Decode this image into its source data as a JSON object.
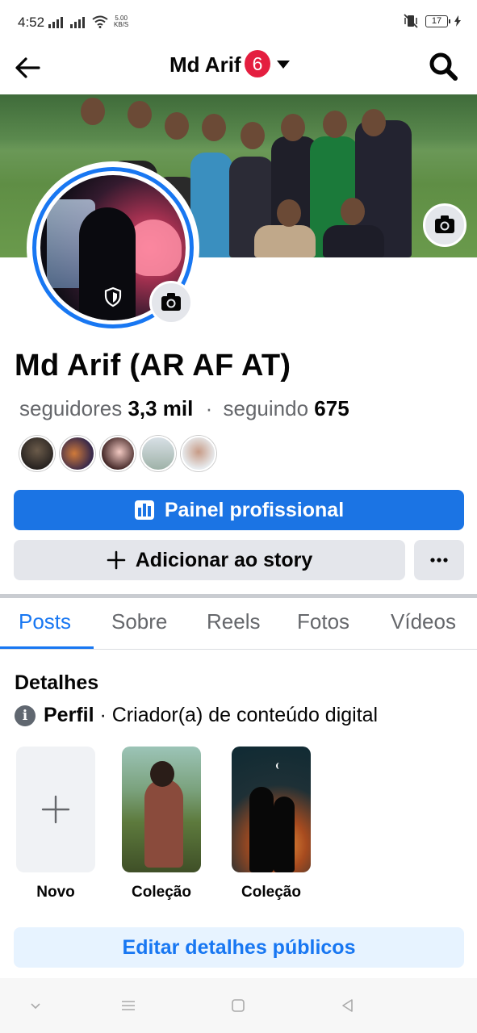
{
  "status": {
    "time": "4:52",
    "netspeed_value": "5.00",
    "netspeed_unit": "KB/S",
    "battery": "17"
  },
  "header": {
    "title": "Md Arif",
    "badge": "6"
  },
  "profile": {
    "name": "Md Arif (AR AF AT)",
    "followers_label": "seguidores",
    "followers_value": "3,3 mil",
    "separator": "·",
    "following_label": "seguindo",
    "following_value": "675"
  },
  "buttons": {
    "dashboard": "Painel profissional",
    "add_story": "Adicionar ao story",
    "more": "···",
    "edit_details": "Editar detalhes públicos"
  },
  "tabs": [
    {
      "label": "Posts",
      "active": true
    },
    {
      "label": "Sobre"
    },
    {
      "label": "Reels"
    },
    {
      "label": "Fotos"
    },
    {
      "label": "Vídeos"
    }
  ],
  "details": {
    "title": "Detalhes",
    "profile_key": "Perfil",
    "profile_value": "· Criador(a) de conteúdo digital"
  },
  "featured": [
    {
      "label": "Novo"
    },
    {
      "label": "Coleção"
    },
    {
      "label": "Coleção"
    }
  ],
  "colors": {
    "accent": "#1877f2",
    "badge": "#e41e3f",
    "button_gray": "#e4e6eb",
    "light_blue": "#e7f3ff"
  },
  "icons": [
    "back-arrow-icon",
    "caret-down-icon",
    "search-icon",
    "camera-icon",
    "shield-icon",
    "dashboard-icon",
    "plus-icon",
    "more-icon",
    "info-icon"
  ]
}
